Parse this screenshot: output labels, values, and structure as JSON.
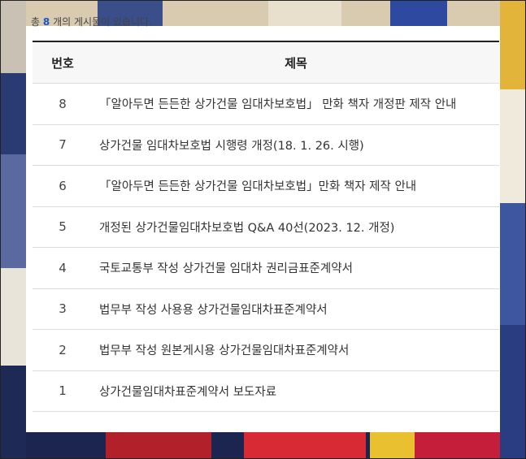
{
  "board": {
    "count_prefix": "총",
    "count": "8",
    "count_suffix": "개의 게시물이 있습니다.",
    "header": {
      "num": "번호",
      "title": "제목"
    },
    "rows": [
      {
        "num": "8",
        "title": "「알아두면 든든한 상가건물 임대차보호법」 만화 책자 개정판 제작 안내"
      },
      {
        "num": "7",
        "title": "상가건물 임대차보호법 시행령 개정(18. 1. 26. 시행)"
      },
      {
        "num": "6",
        "title": "「알아두면 든든한 상가건물 임대차보호법」만화 책자 제작 안내"
      },
      {
        "num": "5",
        "title": "개정된 상가건물임대차보호법 Q&A 40선(2023. 12. 개정)"
      },
      {
        "num": "4",
        "title": "국토교통부 작성 상가건물 임대차 권리금표준계약서"
      },
      {
        "num": "3",
        "title": "법무부 작성 사용용 상가건물임대차표준계약서"
      },
      {
        "num": "2",
        "title": "법무부 작성 원본게시용 상가건물임대차표준계약서"
      },
      {
        "num": "1",
        "title": "상가건물임대차표준계약서 보도자료"
      }
    ]
  }
}
